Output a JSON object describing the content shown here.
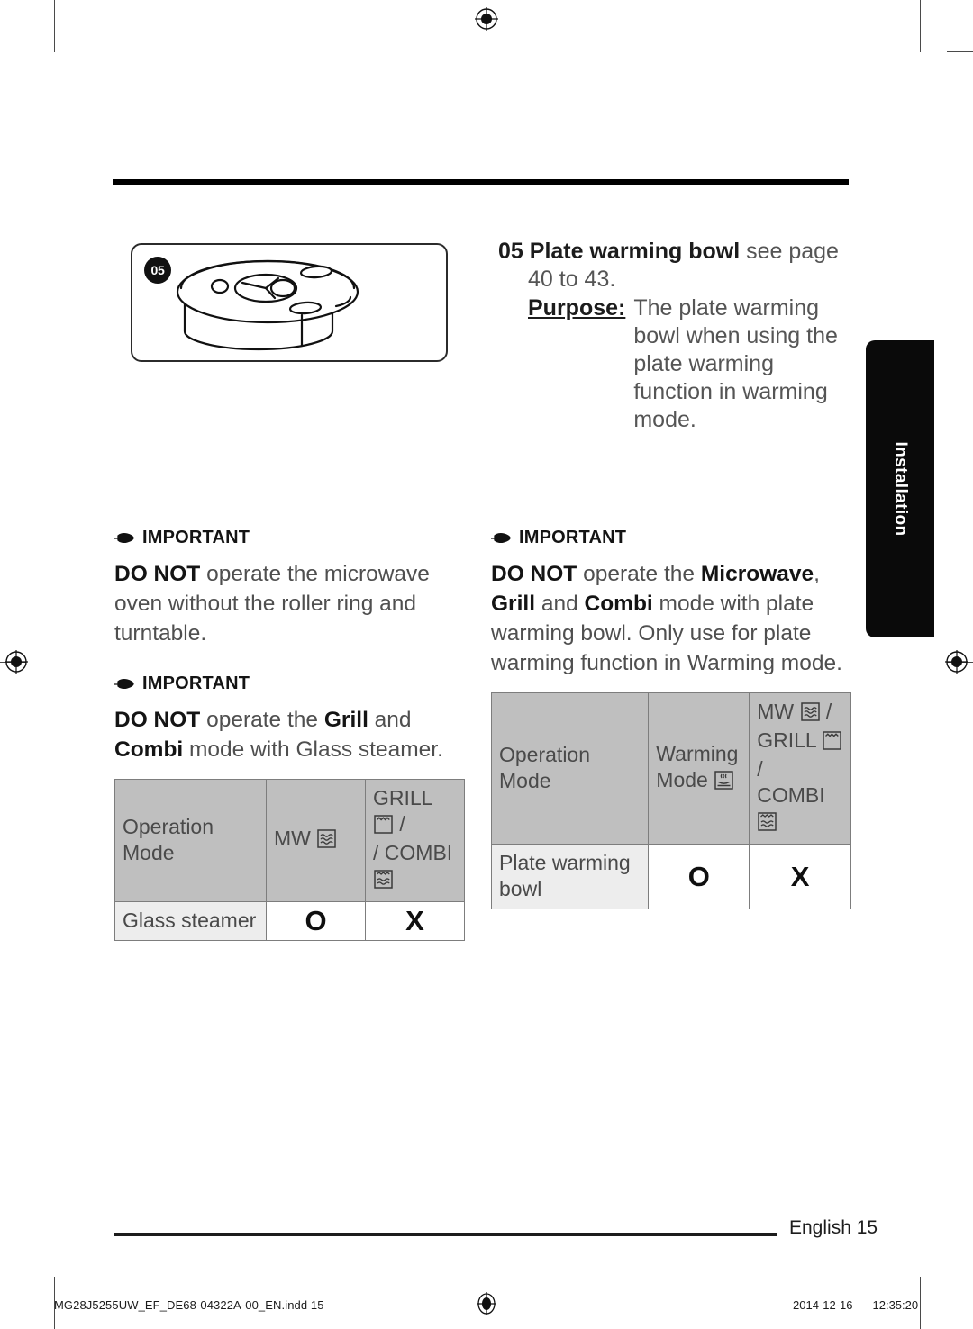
{
  "page": {
    "side_tab_label": "Installation",
    "footer_page_label": "English 15",
    "print_footer_file": "MG28J5255UW_EF_DE68-04322A-00_EN.indd   15",
    "print_footer_date": "2014-12-16",
    "print_footer_time": "12:35:20"
  },
  "illustration": {
    "badge_number": "05",
    "alt": "plate-warming-bowl-line-drawing"
  },
  "item": {
    "number": "05",
    "name": "Plate warming bowl",
    "see_page": " see page",
    "page_range": "40 to 43.",
    "purpose_label": "Purpose:",
    "purpose_text": "The plate warming bowl when using the plate warming function in warming mode."
  },
  "important_blocks": {
    "left": [
      {
        "heading": "IMPORTANT",
        "text_parts": [
          {
            "text": "DO NOT",
            "bold": true
          },
          {
            "text": " operate the microwave oven without the roller ring and turntable.",
            "bold": false
          }
        ]
      },
      {
        "heading": "IMPORTANT",
        "text_parts": [
          {
            "text": "DO NOT",
            "bold": true
          },
          {
            "text": " operate the ",
            "bold": false
          },
          {
            "text": "Grill",
            "bold": true
          },
          {
            "text": " and ",
            "bold": false
          },
          {
            "text": "Combi",
            "bold": true
          },
          {
            "text": " mode with Glass steamer.",
            "bold": false
          }
        ]
      }
    ],
    "right": [
      {
        "heading": "IMPORTANT",
        "text_parts": [
          {
            "text": "DO NOT",
            "bold": true
          },
          {
            "text": " operate the ",
            "bold": false
          },
          {
            "text": "Microwave",
            "bold": true
          },
          {
            "text": ", ",
            "bold": false
          },
          {
            "text": "Grill",
            "bold": true
          },
          {
            "text": " and ",
            "bold": false
          },
          {
            "text": "Combi",
            "bold": true
          },
          {
            "text": " mode with plate warming bowl. Only use for plate warming function in Warming mode.",
            "bold": false
          }
        ]
      }
    ]
  },
  "tables": {
    "glass_steamer": {
      "headers": [
        {
          "text": "Operation Mode",
          "icons": []
        },
        {
          "text": "MW",
          "icons": [
            "microwave-icon"
          ]
        },
        {
          "text": "GRILL",
          "icons": [
            "grill-icon"
          ],
          "text2": "/ COMBI",
          "icons2": [
            "combi-icon"
          ]
        }
      ],
      "rows": [
        {
          "label": "Glass steamer",
          "values": [
            "O",
            "X"
          ]
        }
      ]
    },
    "plate_warming_bowl": {
      "headers": [
        {
          "text": "Operation Mode",
          "icons": []
        },
        {
          "text": "Warming Mode",
          "icons": [
            "warming-icon"
          ]
        },
        {
          "text": "MW",
          "icons": [
            "microwave-icon"
          ],
          "text2": "GRILL",
          "icons2": [
            "grill-icon"
          ],
          "text3": "COMBI",
          "icons3": [
            "combi-icon"
          ]
        }
      ],
      "rows": [
        {
          "label": "Plate warming bowl",
          "values": [
            "O",
            "X"
          ]
        }
      ]
    }
  },
  "colors": {
    "table_header_gray": "#bfbfbf",
    "table_rowlabel_gray": "#ededed",
    "text_gray": "#4f4f4f",
    "text_dark": "#141414",
    "tab_black": "#0a0a0a"
  }
}
